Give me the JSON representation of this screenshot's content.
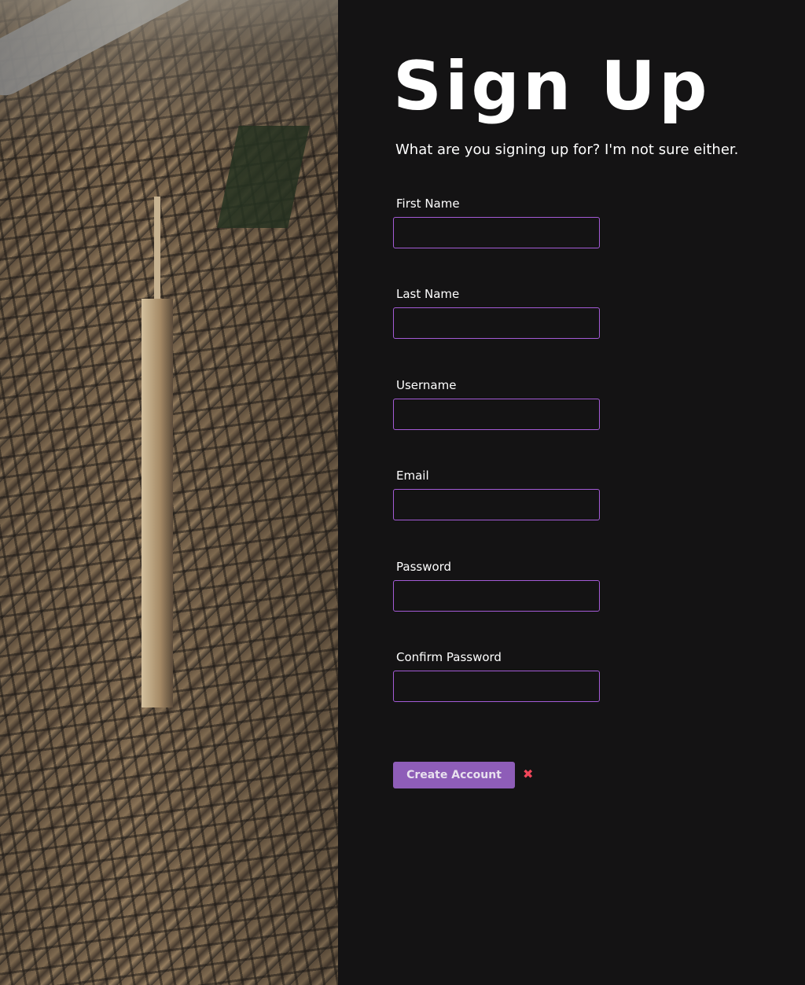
{
  "hero": {
    "image_alt": "aerial city skyline photo"
  },
  "header": {
    "title": "Sign Up",
    "subtitle": "What are you signing up for? I'm not sure either."
  },
  "form": {
    "fields": [
      {
        "label": "First Name",
        "value": "",
        "placeholder": ""
      },
      {
        "label": "Last Name",
        "value": "",
        "placeholder": ""
      },
      {
        "label": "Username",
        "value": "",
        "placeholder": ""
      },
      {
        "label": "Email",
        "value": "",
        "placeholder": ""
      },
      {
        "label": "Password",
        "value": "",
        "placeholder": ""
      },
      {
        "label": "Confirm Password",
        "value": "",
        "placeholder": ""
      }
    ],
    "submit_label": "Create Account",
    "status_icon": "✖"
  },
  "colors": {
    "background": "#141314",
    "input_border": "#a45bd6",
    "button": "#8e5db8",
    "error": "#f0465a"
  }
}
